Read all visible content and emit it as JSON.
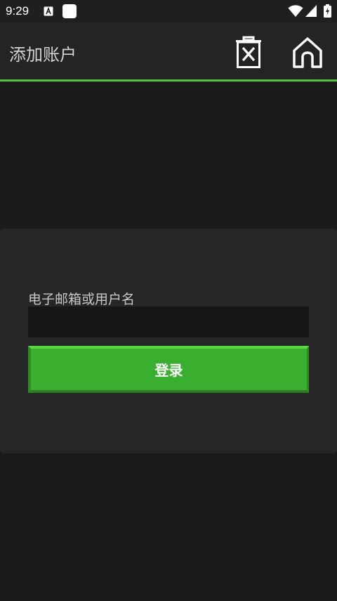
{
  "status_bar": {
    "time": "9:29",
    "icons": [
      "a-icon",
      "square-icon",
      "wifi-icon",
      "signal-icon",
      "battery-icon"
    ]
  },
  "app_bar": {
    "title": "添加账户",
    "actions": [
      "delete-icon",
      "home-icon"
    ],
    "accent_color": "#52c634"
  },
  "login_form": {
    "field_label": "电子邮箱或用户名",
    "field_value": "",
    "button_label": "登录",
    "button_color": "#3aaf2f"
  }
}
